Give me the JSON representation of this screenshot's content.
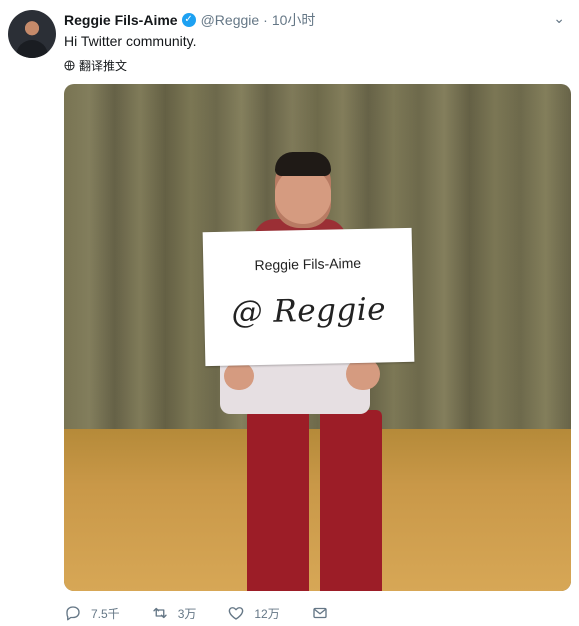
{
  "tweet": {
    "author_name": "Reggie Fils-Aime",
    "handle": "@Reggie",
    "time": "10小时",
    "text": "Hi Twitter community.",
    "translate_label": "翻译推文"
  },
  "icons": {
    "verified": "verified-icon",
    "menu": "chevron-down-icon",
    "globe": "globe-icon",
    "reply": "reply-icon",
    "retweet": "retweet-icon",
    "like": "heart-icon",
    "message": "message-icon"
  },
  "media": {
    "sign_name": "Reggie Fils-Aime",
    "sign_handle": "@ Reggie"
  },
  "actions": {
    "replies": "7.5千",
    "retweets": "3万",
    "likes": "12万"
  },
  "colors": {
    "verified_blue": "#1da1f2",
    "muted_text": "#657786"
  }
}
